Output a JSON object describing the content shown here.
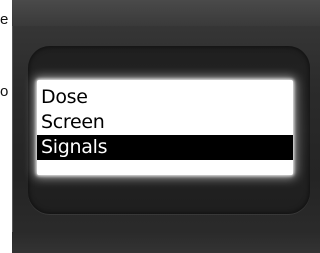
{
  "background_text": [
    "e",
    "o"
  ],
  "menu": {
    "items": [
      {
        "label": "Dose"
      },
      {
        "label": "Screen"
      },
      {
        "label": "Signals"
      }
    ],
    "selected_label": "Signals"
  },
  "colors": {
    "screen_background": "#ffffff",
    "selection_background": "#000000",
    "selection_text": "#ffffff",
    "bezel": "#2b2b2b"
  }
}
